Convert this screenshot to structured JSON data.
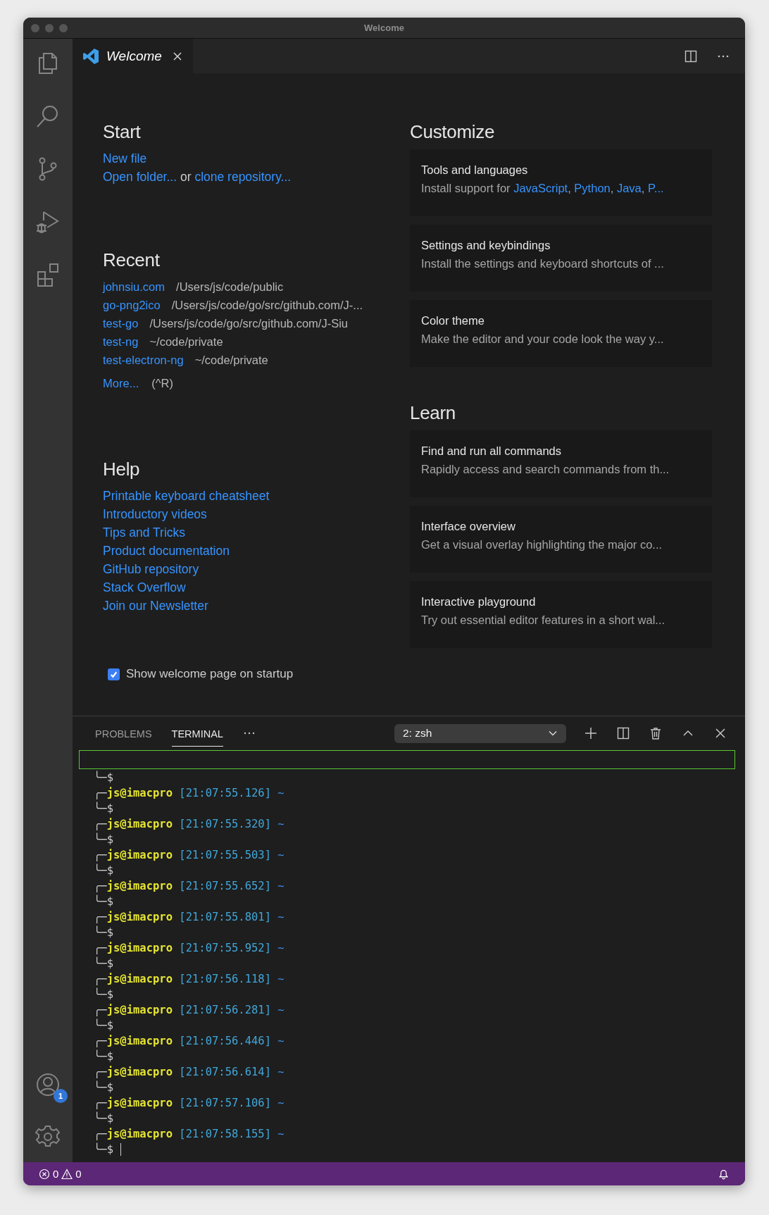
{
  "window": {
    "title": "Welcome"
  },
  "activity_bar": {
    "account_badge": "1"
  },
  "tabs": [
    {
      "label": "Welcome",
      "selected": true
    }
  ],
  "welcome": {
    "start": {
      "heading": "Start",
      "lines": [
        [
          {
            "text": "New file",
            "link": true
          }
        ],
        [
          {
            "text": "Open folder...",
            "link": true
          },
          {
            "text": " or ",
            "link": false
          },
          {
            "text": "clone repository...",
            "link": true
          }
        ]
      ]
    },
    "recent": {
      "heading": "Recent",
      "items": [
        {
          "name": "johnsiu.com",
          "path": "/Users/js/code/public"
        },
        {
          "name": "go-png2ico",
          "path": "/Users/js/code/go/src/github.com/J-..."
        },
        {
          "name": "test-go",
          "path": "/Users/js/code/go/src/github.com/J-Siu"
        },
        {
          "name": "test-ng",
          "path": "~/code/private"
        },
        {
          "name": "test-electron-ng",
          "path": "~/code/private"
        }
      ],
      "more": {
        "label": "More...",
        "shortcut": "(^R)"
      }
    },
    "help": {
      "heading": "Help",
      "links": [
        "Printable keyboard cheatsheet",
        "Introductory videos",
        "Tips and Tricks",
        "Product documentation",
        "GitHub repository",
        "Stack Overflow",
        "Join our Newsletter"
      ]
    },
    "show_on_startup": {
      "label": "Show welcome page on startup",
      "checked": true
    },
    "customize": {
      "heading": "Customize",
      "cards": [
        {
          "title": "Tools and languages",
          "description": [
            {
              "text": "Install support for ",
              "link": false
            },
            {
              "text": "JavaScript",
              "link": true
            },
            {
              "text": ", ",
              "link": false
            },
            {
              "text": "Python",
              "link": true
            },
            {
              "text": ", ",
              "link": false
            },
            {
              "text": "Java",
              "link": true
            },
            {
              "text": ", ",
              "link": false
            },
            {
              "text": "P...",
              "link": true
            }
          ]
        },
        {
          "title": "Settings and keybindings",
          "description": [
            {
              "text": "Install the settings and keyboard shortcuts of ...",
              "link": false
            }
          ]
        },
        {
          "title": "Color theme",
          "description": [
            {
              "text": "Make the editor and your code look the way y...",
              "link": false
            }
          ]
        }
      ]
    },
    "learn": {
      "heading": "Learn",
      "cards": [
        {
          "title": "Find and run all commands",
          "description": [
            {
              "text": "Rapidly access and search commands from th...",
              "link": false
            }
          ]
        },
        {
          "title": "Interface overview",
          "description": [
            {
              "text": "Get a visual overlay highlighting the major co...",
              "link": false
            }
          ]
        },
        {
          "title": "Interactive playground",
          "description": [
            {
              "text": "Try out essential editor features in a short wal...",
              "link": false
            }
          ]
        }
      ]
    }
  },
  "panel": {
    "tabs": [
      {
        "label": "PROBLEMS",
        "selected": false
      },
      {
        "label": "TERMINAL",
        "selected": true
      }
    ],
    "terminal_dropdown": "2: zsh",
    "lines": [
      {
        "kind": "end",
        "text": "╰─$",
        "cursor": false
      },
      {
        "kind": "prompt",
        "corner": "╭─",
        "user": "js@imacpro",
        "time": "[21:07:55.126]",
        "dir": "~"
      },
      {
        "kind": "end",
        "text": "╰─$",
        "cursor": false
      },
      {
        "kind": "prompt",
        "corner": "╭─",
        "user": "js@imacpro",
        "time": "[21:07:55.320]",
        "dir": "~"
      },
      {
        "kind": "end",
        "text": "╰─$",
        "cursor": false
      },
      {
        "kind": "prompt",
        "corner": "╭─",
        "user": "js@imacpro",
        "time": "[21:07:55.503]",
        "dir": "~"
      },
      {
        "kind": "end",
        "text": "╰─$",
        "cursor": false
      },
      {
        "kind": "prompt",
        "corner": "╭─",
        "user": "js@imacpro",
        "time": "[21:07:55.652]",
        "dir": "~"
      },
      {
        "kind": "end",
        "text": "╰─$",
        "cursor": false
      },
      {
        "kind": "prompt",
        "corner": "╭─",
        "user": "js@imacpro",
        "time": "[21:07:55.801]",
        "dir": "~"
      },
      {
        "kind": "end",
        "text": "╰─$",
        "cursor": false
      },
      {
        "kind": "prompt",
        "corner": "╭─",
        "user": "js@imacpro",
        "time": "[21:07:55.952]",
        "dir": "~"
      },
      {
        "kind": "end",
        "text": "╰─$",
        "cursor": false
      },
      {
        "kind": "prompt",
        "corner": "╭─",
        "user": "js@imacpro",
        "time": "[21:07:56.118]",
        "dir": "~"
      },
      {
        "kind": "end",
        "text": "╰─$",
        "cursor": false
      },
      {
        "kind": "prompt",
        "corner": "╭─",
        "user": "js@imacpro",
        "time": "[21:07:56.281]",
        "dir": "~"
      },
      {
        "kind": "end",
        "text": "╰─$",
        "cursor": false
      },
      {
        "kind": "prompt",
        "corner": "╭─",
        "user": "js@imacpro",
        "time": "[21:07:56.446]",
        "dir": "~"
      },
      {
        "kind": "end",
        "text": "╰─$",
        "cursor": false
      },
      {
        "kind": "prompt",
        "corner": "╭─",
        "user": "js@imacpro",
        "time": "[21:07:56.614]",
        "dir": "~"
      },
      {
        "kind": "end",
        "text": "╰─$",
        "cursor": false
      },
      {
        "kind": "prompt",
        "corner": "╭─",
        "user": "js@imacpro",
        "time": "[21:07:57.106]",
        "dir": "~"
      },
      {
        "kind": "end",
        "text": "╰─$",
        "cursor": false
      },
      {
        "kind": "prompt",
        "corner": "╭─",
        "user": "js@imacpro",
        "time": "[21:07:58.155]",
        "dir": "~"
      },
      {
        "kind": "end",
        "text": "╰─$",
        "cursor": true
      }
    ]
  },
  "status_bar": {
    "errors": "0",
    "warnings": "0"
  }
}
